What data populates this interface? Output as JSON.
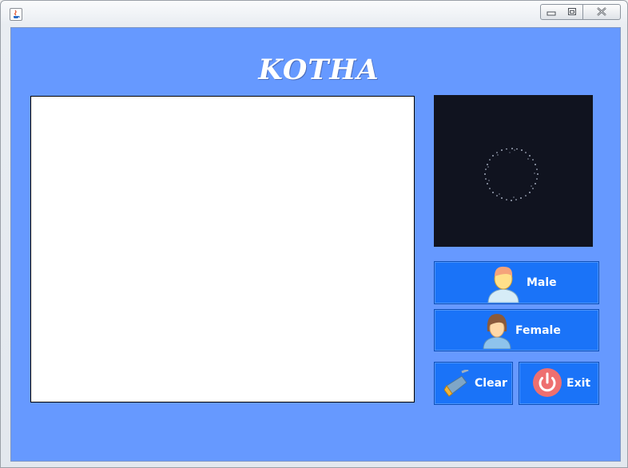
{
  "app": {
    "title": "KOTHA",
    "text_area": {
      "value": ""
    }
  },
  "buttons": {
    "male_label": "Male",
    "female_label": "Female",
    "clear_label": "Clear",
    "exit_label": "Exit"
  },
  "icons": {
    "app": "java-cup-icon",
    "minimize": "minimize-icon",
    "maximize": "maximize-icon",
    "close": "close-icon",
    "male": "male-avatar-icon",
    "female": "female-avatar-icon",
    "clear": "broom-icon",
    "exit": "power-icon"
  },
  "colors": {
    "panel_background": "#6699ff",
    "button_background": "#1a73f8",
    "visualizer_background": "#10131f",
    "exit_icon": "#ee6f6f"
  }
}
